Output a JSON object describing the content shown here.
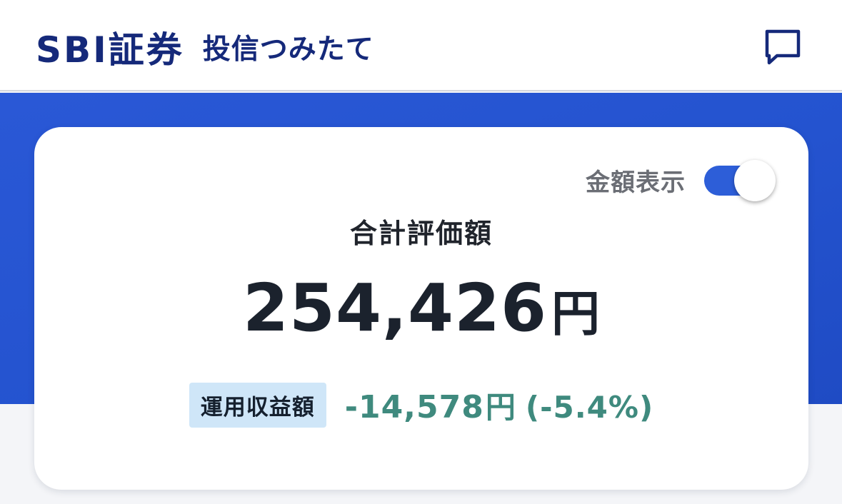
{
  "header": {
    "brand_logo": "SBI証券",
    "product_name": "投信つみたて",
    "chat_icon": "chat-bubble-icon",
    "brand_color": "#15297a"
  },
  "summary": {
    "toggle_label": "金額表示",
    "toggle_on": true,
    "total_label": "合計評価額",
    "total_amount": "254,426",
    "currency_unit": "円",
    "pl_label": "運用収益額",
    "pl_amount": "-14,578",
    "pl_percent": "(-5.4%)",
    "accent_color": "#2d5ed8",
    "pl_color": "#3f8a7e"
  }
}
